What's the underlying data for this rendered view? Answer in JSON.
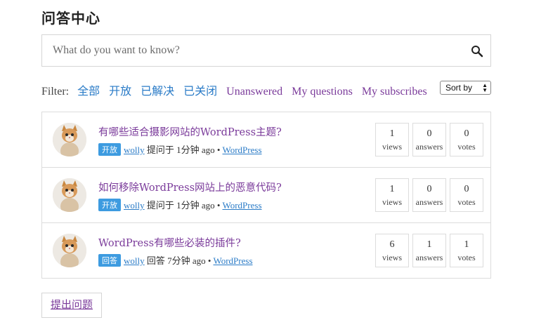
{
  "page": {
    "title": "问答中心"
  },
  "search": {
    "placeholder": "What do you want to know?"
  },
  "filter": {
    "label": "Filter:",
    "items": [
      {
        "label": "全部",
        "color": "#2a7bc7"
      },
      {
        "label": "开放",
        "color": "#2a7bc7"
      },
      {
        "label": "已解决",
        "color": "#2a7bc7"
      },
      {
        "label": "已关闭",
        "color": "#2a7bc7"
      },
      {
        "label": "Unanswered",
        "color": "#7a3a9a"
      },
      {
        "label": "My questions",
        "color": "#7a3a9a"
      },
      {
        "label": "My subscribes",
        "color": "#7a3a9a"
      }
    ],
    "sort_label": "Sort by"
  },
  "questions": [
    {
      "title": "有哪些适合摄影网站的WordPress主题?",
      "status": "开放",
      "author": "wolly",
      "action": "提问于",
      "time": "1分钟 ago",
      "separator": "•",
      "category": "WordPress",
      "views": "1",
      "views_label": "views",
      "answers": "0",
      "answers_label": "answers",
      "votes": "0",
      "votes_label": "votes"
    },
    {
      "title": "如何移除WordPress网站上的恶意代码?",
      "status": "开放",
      "author": "wolly",
      "action": "提问于",
      "time": "1分钟 ago",
      "separator": "•",
      "category": "WordPress",
      "views": "1",
      "views_label": "views",
      "answers": "0",
      "answers_label": "answers",
      "votes": "0",
      "votes_label": "votes"
    },
    {
      "title": "WordPress有哪些必装的插件?",
      "status": "回答",
      "author": "wolly",
      "action": "回答",
      "time": "7分钟 ago",
      "separator": "•",
      "category": "WordPress",
      "views": "6",
      "views_label": "views",
      "answers": "1",
      "answers_label": "answers",
      "votes": "1",
      "votes_label": "votes"
    }
  ],
  "ask_button": {
    "label": "提出问题"
  },
  "colors": {
    "link_purple": "#7a3a9a",
    "link_blue": "#2a7bc7",
    "badge_blue": "#3d9be0"
  }
}
